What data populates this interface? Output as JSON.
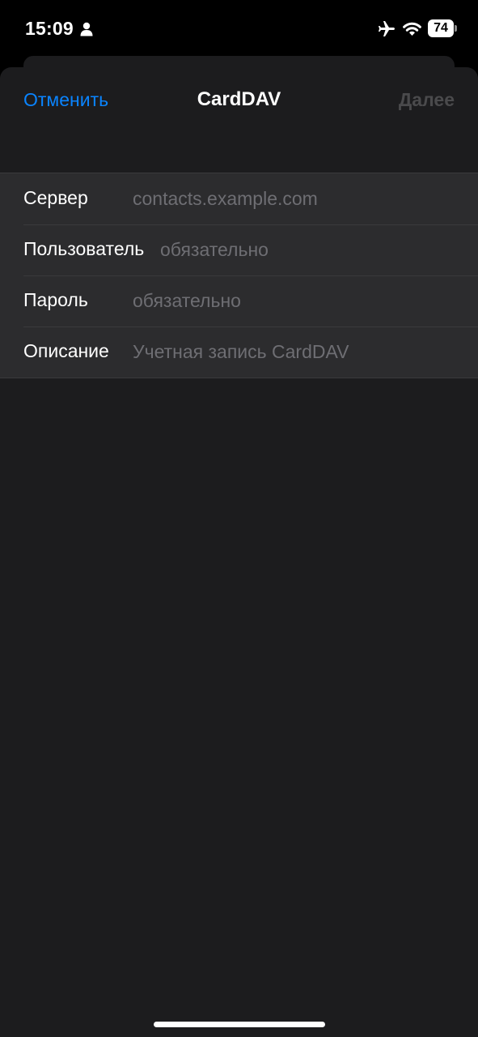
{
  "status_bar": {
    "time": "15:09",
    "battery_level": "74",
    "icons": [
      "person-icon",
      "airplane-icon",
      "wifi-icon",
      "battery-icon"
    ]
  },
  "nav": {
    "cancel_label": "Отменить",
    "title": "CardDAV",
    "next_label": "Далее"
  },
  "form": {
    "rows": [
      {
        "label": "Сервер",
        "value": "",
        "placeholder": "contacts.example.com"
      },
      {
        "label": "Пользователь",
        "value": "",
        "placeholder": "обязательно"
      },
      {
        "label": "Пароль",
        "value": "",
        "placeholder": "обязательно"
      },
      {
        "label": "Описание",
        "value": "",
        "placeholder": "Учетная запись CardDAV"
      }
    ]
  },
  "colors": {
    "accent": "#0a84ff",
    "background": "#1c1c1e",
    "group_background": "#2c2c2e",
    "disabled_text": "#4a4a4c",
    "placeholder_text": "#6e6e73"
  }
}
